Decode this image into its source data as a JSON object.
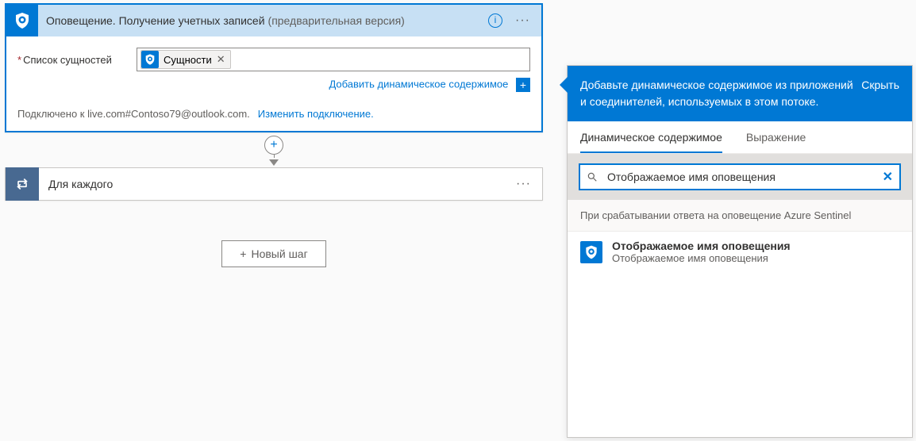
{
  "action1": {
    "title": "Оповещение. Получение учетных записей",
    "suffix": "(предварительная версия)",
    "param_label": "Список сущностей",
    "token_label": "Сущности",
    "add_dynamic": "Добавить динамическое содержимое",
    "connected_to": "Подключено к live.com#Contoso79@outlook.com.",
    "change_connection": "Изменить подключение."
  },
  "action2": {
    "title": "Для каждого"
  },
  "new_step": {
    "label": "Новый шаг"
  },
  "dyn": {
    "header_text": "Добавьте динамическое содержимое из приложений и соединителей, используемых в этом потоке.",
    "hide": "Скрыть",
    "tab_dynamic": "Динамическое содержимое",
    "tab_expression": "Выражение",
    "search_value": "Отображаемое имя оповещения",
    "group_header": "При срабатывании ответа на оповещение Azure Sentinel",
    "item_title": "Отображаемое имя оповещения",
    "item_desc": "Отображаемое имя оповещения"
  }
}
